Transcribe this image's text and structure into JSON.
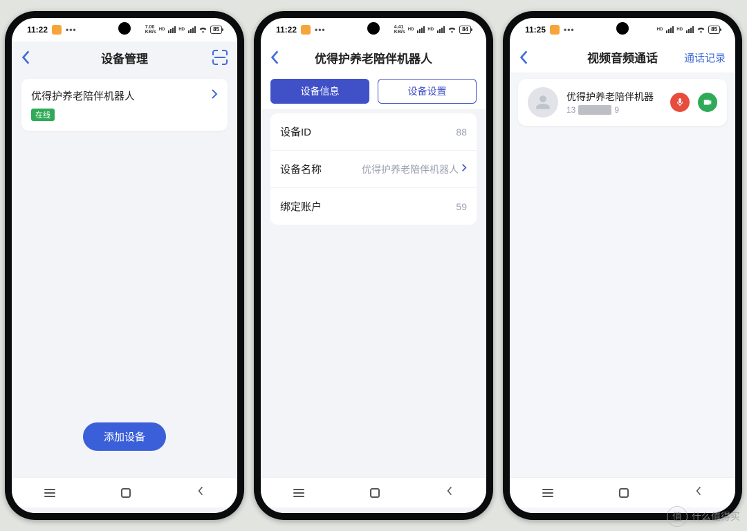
{
  "watermark": "什么值得买",
  "phones": [
    {
      "status": {
        "time": "11:22",
        "speed_top": "7.00",
        "speed_bot": "KB/s",
        "batt": "85"
      },
      "header": {
        "title": "设备管理"
      },
      "device": {
        "name": "优得护养老陪伴机器人",
        "status": "在线"
      },
      "add_button": "添加设备"
    },
    {
      "status": {
        "time": "11:22",
        "speed_top": "4.41",
        "speed_bot": "KB/s",
        "batt": "84"
      },
      "header": {
        "title": "优得护养老陪伴机器人"
      },
      "tabs": {
        "info": "设备信息",
        "settings": "设备设置"
      },
      "rows": {
        "id_label": "设备ID",
        "id_value": "88",
        "name_label": "设备名称",
        "name_value": "优得护养老陪伴机器人",
        "acct_label": "绑定账户",
        "acct_value": "59"
      }
    },
    {
      "status": {
        "time": "11:25",
        "speed_top": "",
        "speed_bot": "",
        "batt": "85"
      },
      "header": {
        "title": "视频音频通话",
        "action": "通话记录"
      },
      "contact": {
        "name": "优得护养老陪伴机器",
        "sub_prefix": "13",
        "sub_suffix": "9"
      }
    }
  ]
}
